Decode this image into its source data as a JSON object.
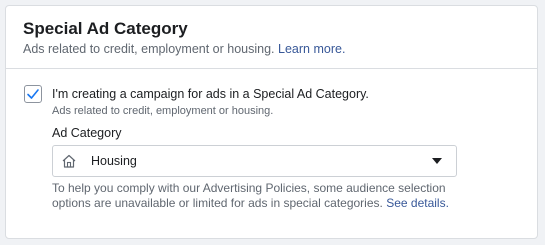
{
  "section": {
    "title": "Special Ad Category",
    "subtitle": "Ads related to credit, employment or housing.",
    "learn_more": "Learn more."
  },
  "checkbox": {
    "checked": true,
    "label": "I'm creating a campaign for ads in a Special Ad Category.",
    "sublabel": "Ads related to credit, employment or housing."
  },
  "ad_category": {
    "label": "Ad Category",
    "selected": "Housing",
    "icon": "house-icon"
  },
  "help": {
    "text": "To help you comply with our Advertising Policies, some audience selection options are unavailable or limited for ads in special categories.",
    "link": "See details."
  },
  "colors": {
    "accent": "#1877f2",
    "link": "#385898",
    "text": "#1c1e21",
    "secondary_text": "#606770"
  }
}
